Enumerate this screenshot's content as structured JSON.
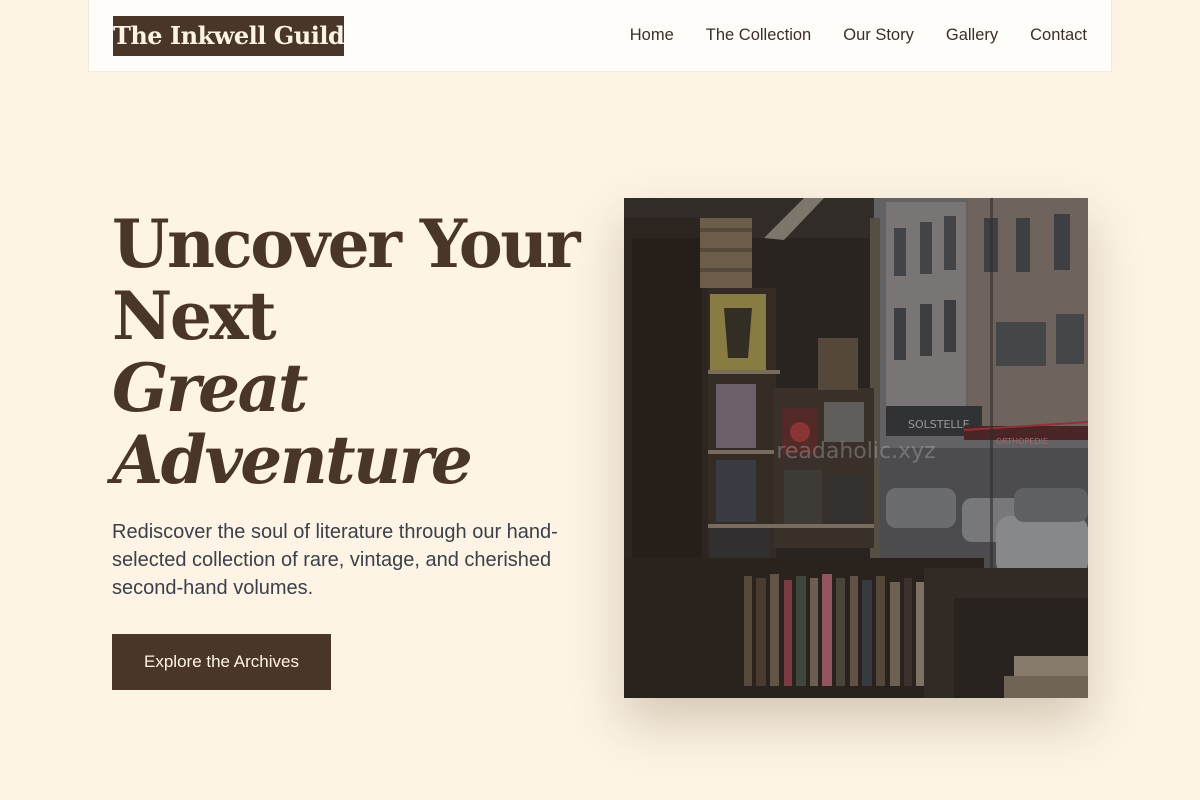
{
  "header": {
    "logo": "The Inkwell Guild",
    "nav": [
      "Home",
      "The Collection",
      "Our Story",
      "Gallery",
      "Contact"
    ]
  },
  "hero": {
    "title_line1": "Uncover Your",
    "title_line2": "Next",
    "title_line3": "Great",
    "title_line4": "Adventure",
    "subtitle": "Rediscover the soul of literature through our hand-selected collection of rare, vintage, and cherished second-hand volumes.",
    "cta_label": "Explore the Archives"
  },
  "image": {
    "watermark": "readaholic.xyz",
    "shop_sign": "SOLSTELLE",
    "shop_sign2": "ORTHOPEDIE"
  },
  "colors": {
    "background": "#fdf4e5",
    "brand_brown": "#4a3628",
    "text_dark": "#3b4049"
  }
}
